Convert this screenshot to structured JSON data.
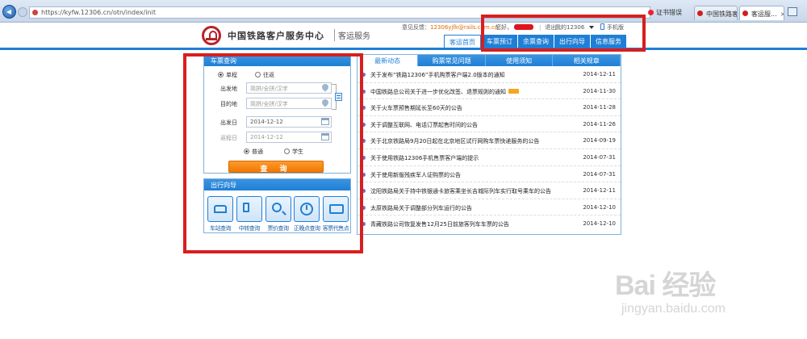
{
  "browser": {
    "url": "https://kyfw.12306.cn/otn/index/init",
    "cert_label": "证书错误",
    "tabs": [
      {
        "label": "中国铁路客户服..."
      },
      {
        "label": "客运服..."
      }
    ]
  },
  "header": {
    "brand": "中国铁路客户服务中心",
    "brand_sub": "客运服务",
    "feedback_label": "意见反馈：",
    "feedback_email": "12306yjfk@rails.com.cn",
    "greeting": "您好，",
    "logout": "退出",
    "my12306": "我的12306",
    "mobile": "手机版"
  },
  "main_nav": [
    {
      "label": "客运首页",
      "active": true
    },
    {
      "label": "车票预订",
      "active": false
    },
    {
      "label": "余票查询",
      "active": false
    },
    {
      "label": "出行向导",
      "active": false
    },
    {
      "label": "信息服务",
      "active": false
    }
  ],
  "ticket": {
    "title": "车票查询",
    "trip_one_way": "单程",
    "trip_round": "往返",
    "from_label": "出发地",
    "from_placeholder": "简拼/全拼/汉字",
    "to_label": "目的地",
    "to_placeholder": "简拼/全拼/汉字",
    "depart_label": "出发日",
    "depart_value": "2014-12-12",
    "return_label": "返程日",
    "return_value": "2014-12-12",
    "type_normal": "普通",
    "type_student": "学生",
    "query_button": "查 询"
  },
  "guide": {
    "title": "出行向导",
    "items": [
      {
        "label": "车站查询",
        "icon": "station-icon"
      },
      {
        "label": "中转查询",
        "icon": "transfer-icon"
      },
      {
        "label": "票价查询",
        "icon": "price-search-icon"
      },
      {
        "label": "正晚点查询",
        "icon": "clock-icon"
      },
      {
        "label": "客票代售点",
        "icon": "agency-icon"
      }
    ]
  },
  "news": {
    "tabs": [
      {
        "label": "最新动态",
        "active": true
      },
      {
        "label": "购票常见问题",
        "active": false
      },
      {
        "label": "使用须知",
        "active": false
      },
      {
        "label": "相关规章",
        "active": false
      }
    ],
    "items": [
      {
        "title": "关于发布“铁路12306”手机购票客户端2.0版本的通知",
        "date": "2014-12-11"
      },
      {
        "title": "中国铁路总公司关于进一步优化改签、退票规则的通知",
        "date": "2014-11-30"
      },
      {
        "title": "关于火车票预售期延长至60天的公告",
        "date": "2014-11-28"
      },
      {
        "title": "关于调整互联网、电话订票起售时间的公告",
        "date": "2014-11-26"
      },
      {
        "title": "关于北京铁路局9月20日起在北京地区试行网购车票快递服务的公告",
        "date": "2014-09-19"
      },
      {
        "title": "关于使用铁路12306手机售票客户端的提示",
        "date": "2014-07-31"
      },
      {
        "title": "关于使用新版残疾军人证购票的公告",
        "date": "2014-07-31"
      },
      {
        "title": "沈阳铁路局关于持中铁银通卡旅客乘坐长吉城际列车实行取号乘车的公告",
        "date": "2014-12-11"
      },
      {
        "title": "太原铁路局关于调整部分列车运行的公告",
        "date": "2014-12-10"
      },
      {
        "title": "青藏铁路公司恢复发售12月25日前旅客列车车票的公告",
        "date": "2014-12-10"
      }
    ]
  },
  "watermark": {
    "logo": "Bai 经验",
    "url": "jingyan.baidu.com"
  },
  "colors": {
    "brand_blue": "#1f7fd6",
    "highlight_red": "#d81e1e",
    "query_orange": "#f07800",
    "logo_red": "#b8222a"
  }
}
